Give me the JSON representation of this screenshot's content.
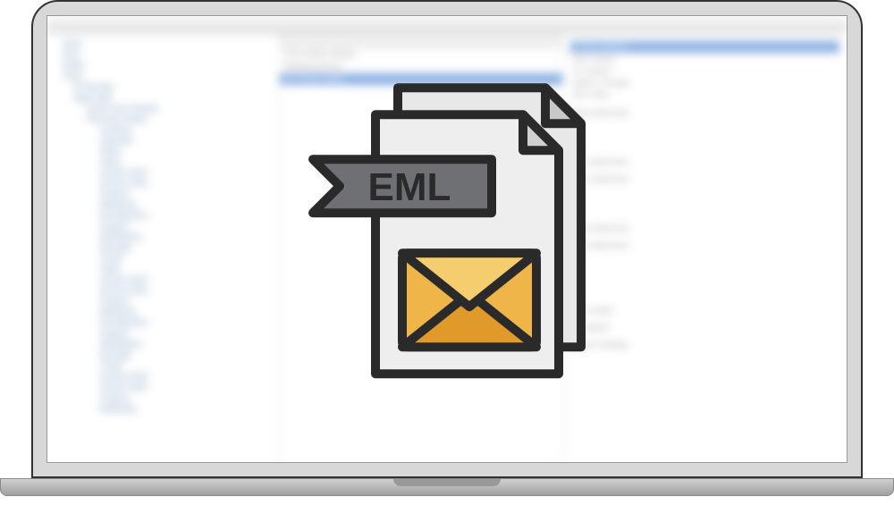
{
  "icon": {
    "label": "EML",
    "filetype": "eml-file-icon",
    "envelope": "envelope-icon"
  },
  "blurred": {
    "sidebar_items": [
      "Inbox",
      "Sent",
      "Drafts",
      "Trash",
      "On My Mac",
      "Apple Mail",
      "Import from Outlook",
      "Personal Folders",
      "Contacts",
      "Calendar",
      "Notes",
      "Tasks",
      "Archive 2019",
      "Archive 2020",
      "Projects",
      "Marketing",
      "Development",
      "Support",
      "Newsletters",
      "Receipts",
      "Travel"
    ],
    "list_rows": [
      "From sender example",
      "Meeting tomorrow",
      "Re: Project update",
      "Invoice attached",
      "Weekly report",
      "Team standup"
    ],
    "preview_lines": [
      "From: sender",
      "To: recipient",
      "Subject: message",
      "Date: today",
      "Body content here"
    ]
  }
}
